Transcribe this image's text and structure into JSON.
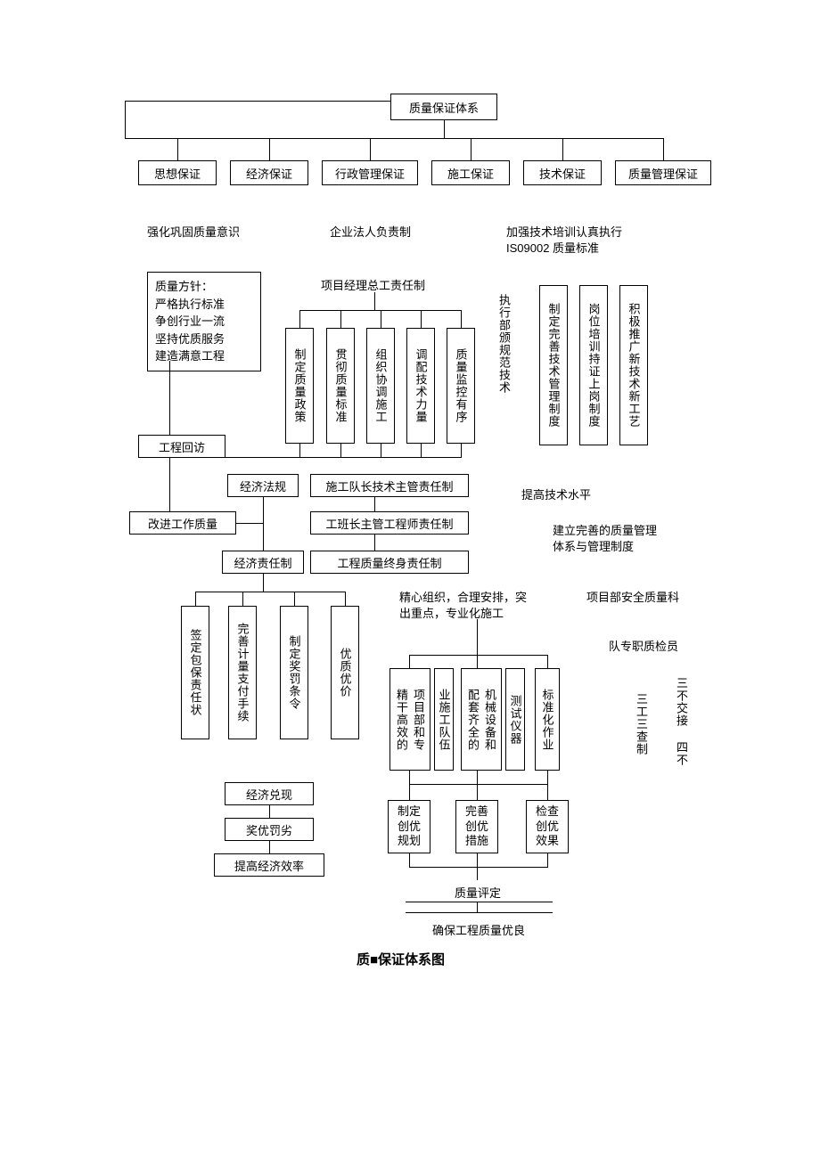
{
  "root": "质量保证体系",
  "level2": {
    "a": "思想保证",
    "b": "经济保证",
    "c": "行政管理保证",
    "d": "施工保证",
    "e": "技术保证",
    "f": "质量管理保证"
  },
  "labels": {
    "l1": "强化巩固质量意识",
    "l2": "企业法人负责制",
    "l3a": "加强技术培训认真执行",
    "l3b": "IS09002 质量标准",
    "pm": "项目经理总工责任制",
    "sq_leader": "施工队长技术主管责任制",
    "foreman": "工班长主管工程师责任制",
    "lifetime": "工程质量终身责任制",
    "tech_level": "提高技术水平",
    "qms1": "建立完善的质量管理",
    "qms2": "体系与管理制度",
    "org1": "精心组织，合理安排，突",
    "org2": "出重点，专业化施工",
    "safety_dept": "项目部安全质量科",
    "inspector": "队专职质检员",
    "eval": "质量评定",
    "ensure": "确保工程质量优良"
  },
  "policy": {
    "title": "质量方针：",
    "l1": "严格执行标准",
    "l2": "争创行业一流",
    "l3": "坚持优质服务",
    "l4": "建造满意工程"
  },
  "left_col": {
    "visit": "工程回访",
    "improve": "改进工作质量",
    "econ_reg": "经济法规",
    "econ_resp": "经济责任制"
  },
  "pm_sub": {
    "a": "制定质量政策",
    "b": "贯彻质量标准",
    "c": "组织协调施工",
    "d": "调配技术力量",
    "e": "质量监控有序"
  },
  "tech_col": {
    "a": "执行部颁规范技术",
    "b": "制定完善技术管理制度",
    "c": "岗位培训持证上岗制度",
    "d": "积极推广新技术新工艺"
  },
  "econ_col": {
    "a": "签定包保责任状",
    "b": "完善计量支付手续",
    "c": "制定奖罚条令",
    "d": "优质优价"
  },
  "econ_flow": {
    "a": "经济兑现",
    "b": "奖优罚劣",
    "c": "提高经济效率"
  },
  "const_col": {
    "a": "精干高效的",
    "a2": "项目部和专",
    "b": "业施工队伍",
    "c": "配套齐全的",
    "c2": "机械设备和",
    "d": "测试仪器",
    "e": "标准化作业"
  },
  "const_flow": {
    "a": "制定创优规划",
    "b": "完善创优措施",
    "c": "检查创优效果"
  },
  "right_v": {
    "a": "三工三查制",
    "b": "三不交接 四不"
  },
  "caption": "质■保证体系图"
}
